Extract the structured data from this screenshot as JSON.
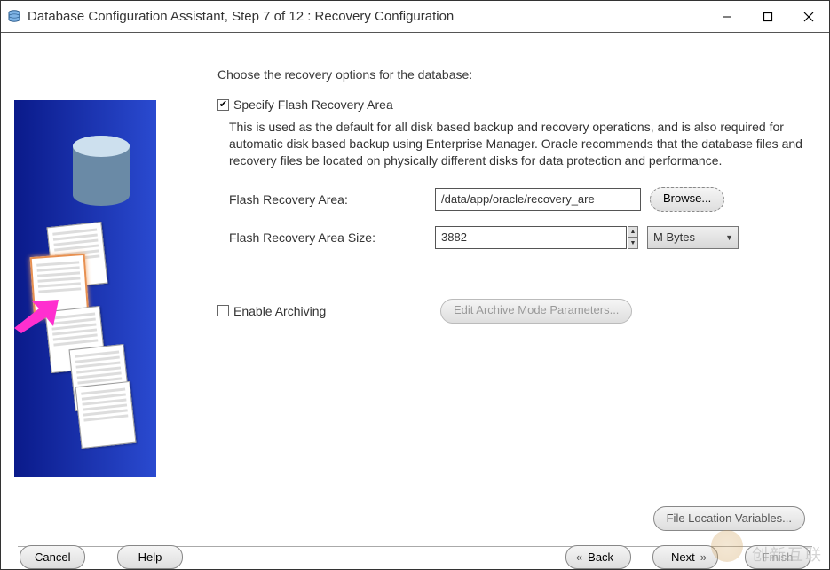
{
  "window": {
    "title": "Database Configuration Assistant, Step 7 of 12 : Recovery Configuration"
  },
  "heading": "Choose the recovery options for the database:",
  "flash": {
    "checkbox_label": "Specify Flash Recovery Area",
    "checked": true,
    "description": "This is used as the default for all disk based backup and recovery operations, and is also required for automatic disk based backup using Enterprise Manager. Oracle recommends that the database files and recovery files be located on physically different disks for data protection and performance.",
    "area_label": "Flash Recovery Area:",
    "area_value": "/data/app/oracle/recovery_are",
    "browse_label": "Browse...",
    "size_label": "Flash Recovery Area Size:",
    "size_value": "3882",
    "size_unit": "M Bytes"
  },
  "archiving": {
    "checkbox_label": "Enable Archiving",
    "checked": false,
    "edit_button": "Edit Archive Mode Parameters..."
  },
  "file_location_variables": "File Location Variables...",
  "footer": {
    "cancel": "Cancel",
    "help": "Help",
    "back": "Back",
    "next": "Next",
    "finish": "Finish"
  },
  "watermark": "创新互联"
}
